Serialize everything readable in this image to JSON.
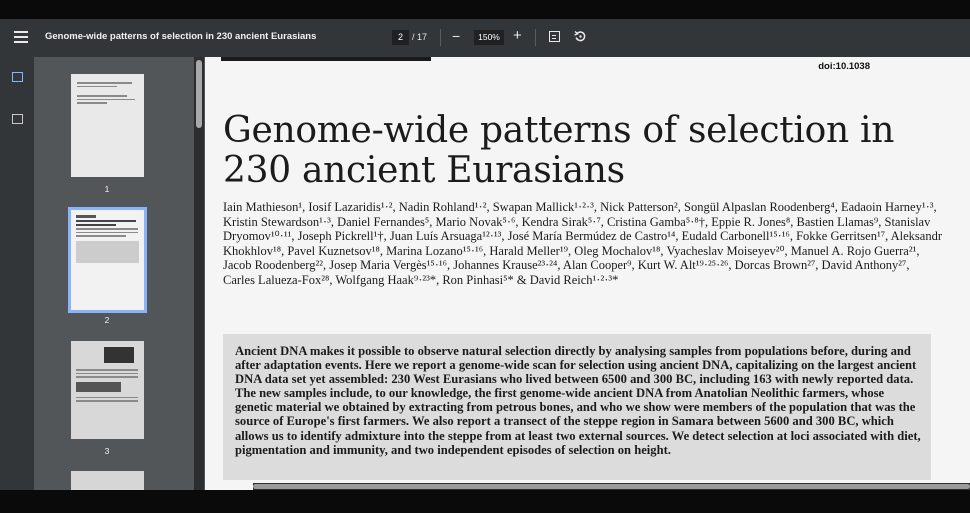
{
  "toolbar": {
    "doc_title": "Genome-wide patterns of selection in 230 ancient Eurasians",
    "current_page": "2",
    "page_total": "/ 17",
    "zoom": "150%",
    "minus": "−",
    "plus": "+"
  },
  "thumbnails": [
    {
      "label": "1",
      "selected": false
    },
    {
      "label": "2",
      "selected": true
    },
    {
      "label": "3",
      "selected": false
    }
  ],
  "page": {
    "doi": "doi:10.1038",
    "title": "Genome-wide patterns of selection in 230 ancient Eurasians",
    "authors": "Iain Mathieson¹, Iosif Lazaridis¹·², Nadin Rohland¹·², Swapan Mallick¹·²·³, Nick Patterson², Songül Alpaslan Roodenberg⁴, Eadaoin Harney¹·³, Kristin Stewardson¹·³, Daniel Fernandes⁵, Mario Novak⁵·⁶, Kendra Sirak⁵·⁷, Cristina Gamba⁵·⁸†, Eppie R. Jones⁸, Bastien Llamas⁹, Stanislav Dryomov¹⁰·¹¹, Joseph Pickrell¹†, Juan Luís Arsuaga¹²·¹³, José María Bermúdez de Castro¹⁴, Eudald Carbonell¹⁵·¹⁶, Fokke Gerritsen¹⁷, Aleksandr Khokhlov¹⁸, Pavel Kuznetsov¹⁸, Marina Lozano¹⁵·¹⁶, Harald Meller¹⁹, Oleg Mochalov¹⁸, Vyacheslav Moiseyev²⁰, Manuel A. Rojo Guerra²¹, Jacob Roodenberg²², Josep Maria Vergès¹⁵·¹⁶, Johannes Krause²³·²⁴, Alan Cooper⁹, Kurt W. Alt¹⁹·²⁵·²⁶, Dorcas Brown²⁷, David Anthony²⁷, Carles Lalueza-Fox²⁸, Wolfgang Haak⁹·²³*, Ron Pinhasi⁵* & David Reich¹·²·³*",
    "abstract": "Ancient DNA makes it possible to observe natural selection directly by analysing samples from populations before, during and after adaptation events. Here we report a genome-wide scan for selection using ancient DNA, capitalizing on the largest ancient DNA data set yet assembled: 230 West Eurasians who lived between 6500 and 300 BC, including 163 with newly reported data. The new samples include, to our knowledge, the first genome-wide ancient DNA from Anatolian Neolithic farmers, whose genetic material we obtained by extracting from petrous bones, and who we show were members of the population that was the source of Europe's first farmers. We also report a transect of the steppe region in Samara between 5600 and 300 BC, which allows us to identify admixture into the steppe from at least two external sources. We detect selection at loci associated with diet, pigmentation and immunity, and two independent episodes of selection on height."
  }
}
